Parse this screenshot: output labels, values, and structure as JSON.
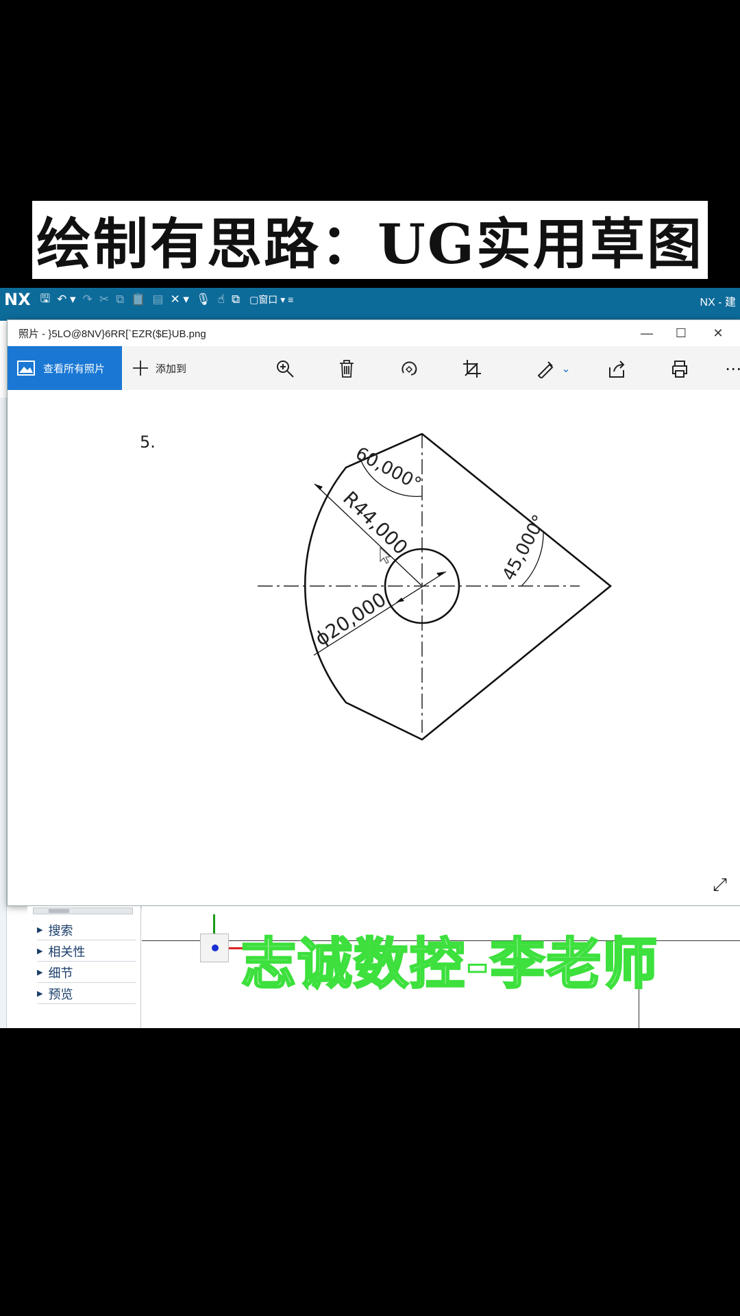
{
  "banner": {
    "text": "绘制有思路：UG实用草图"
  },
  "nx": {
    "logo": "NX",
    "window_menu": "窗口",
    "title_fragment": "NX - 建"
  },
  "photos": {
    "title": "照片 - }5LO@8NV}6RR[`EZR($E}UB.png",
    "view_all": "查看所有照片",
    "add_to": "添加到",
    "icons": [
      "zoom-in-icon",
      "delete-icon",
      "rotate-icon",
      "crop-icon",
      "edit-icon",
      "share-icon",
      "print-icon",
      "more-icon"
    ]
  },
  "drawing": {
    "number": "5.",
    "dim_radius": "R44,000",
    "dim_diameter": "ϕ20,000",
    "dim_angle_60": "60,000°",
    "dim_angle_45": "45,000°"
  },
  "nav": {
    "items": [
      "搜索",
      "相关性",
      "细节",
      "预览"
    ]
  },
  "watermark": "志诚数控-李老师",
  "colors": {
    "nx_bar": "#0d6b9a",
    "accent_blue": "#1a78d4",
    "watermark_green": "#3de03d"
  }
}
